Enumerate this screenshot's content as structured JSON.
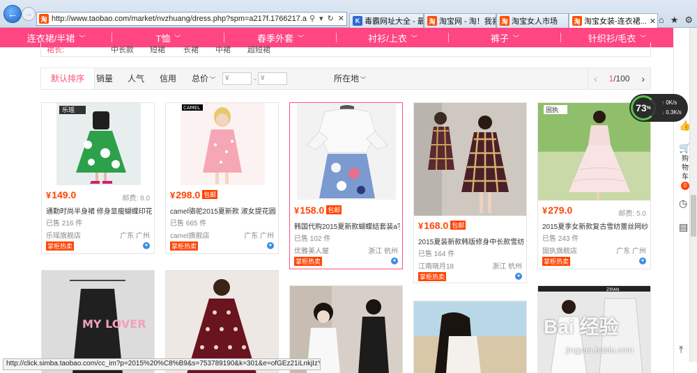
{
  "browser": {
    "url": "http://www.taobao.com/market/nvzhuang/dress.php?spm=a217f.1766217.a214d5w-",
    "tabs": [
      {
        "label": "毒霸网址大全 - 最...",
        "icon": "k",
        "active": false
      },
      {
        "label": "淘宝网 - 淘！我喜欢",
        "icon": "淘",
        "active": false
      },
      {
        "label": "淘宝女人市场",
        "icon": "淘",
        "active": false
      },
      {
        "label": "淘宝女装-连衣裙...",
        "icon": "淘",
        "active": true
      }
    ],
    "status_url": "http://click.simba.taobao.com/cc_im?p=2015%20%C8%B9&s=753789190&k=301&e=ofGEz21iLnkjIzY4..."
  },
  "categories": [
    "连衣裙/半裙",
    "T恤",
    "春季外套",
    "衬衫/上衣",
    "裤子",
    "针织衫/毛衣"
  ],
  "filter_row": {
    "label": "裙长:",
    "options": [
      "中长款",
      "短裙",
      "长裙",
      "中裙",
      "超短裙"
    ]
  },
  "sortbar": {
    "default": "默认排序",
    "sales": "销量",
    "popularity": "人气",
    "credit": "信用",
    "price": "总价",
    "price_min": "¥",
    "price_max": "¥",
    "location": "所在地",
    "page_current": "1",
    "page_total": "/100",
    "prev": "‹",
    "next": "›"
  },
  "products": [
    {
      "price": "149.0",
      "free": "",
      "mail": "邮费: 8.0",
      "title": "通勤时尚半身裙 修身显瘦蝴蝶印花...",
      "sold": "已售 216 件",
      "shop": "乐瑶旗舰店",
      "loc": "广东 广州",
      "badge": "掌柜热卖",
      "brand": "乐瑶"
    },
    {
      "price": "298.0",
      "free": "包邮",
      "mail": "",
      "title": "camel骆驼2015夏新款 淑女提花圆...",
      "sold": "已售 665 件",
      "shop": "camel旗舰店",
      "loc": "广东 广州",
      "badge": "掌柜热卖",
      "brand": "CAMEL"
    },
    {
      "price": "158.0",
      "free": "包邮",
      "mail": "",
      "title": "韩国代购2015夏新款蝴蝶结套装a字...",
      "sold": "已售 102 件",
      "shop": "优雅美人屋",
      "loc": "浙江 杭州",
      "badge": "掌柜热卖",
      "brand": ""
    },
    {
      "price": "168.0",
      "free": "包邮",
      "mail": "",
      "title": "2015夏装新款韩版修身中长款雪纺...",
      "sold": "已售 164 件",
      "shop": "江南晓月18",
      "loc": "浙江 杭州",
      "badge": "掌柜热卖",
      "brand": ""
    },
    {
      "price": "279.0",
      "free": "",
      "mail": "邮费: 5.0",
      "title": "2015夏季女新款复古雪纺蕾丝网纱...",
      "sold": "已售 243 件",
      "shop": "固执旗舰店",
      "loc": "广东 广州",
      "badge": "掌柜热卖",
      "brand": "固执"
    }
  ],
  "second_row": [
    {
      "brand": "MY LOVER"
    },
    {
      "brand": ""
    },
    {
      "brand": ""
    },
    {
      "brand": ""
    },
    {
      "brand": "ZIRAN"
    }
  ],
  "sidebar": {
    "cart_label": "购物车",
    "cart_count": "0"
  },
  "speed": {
    "percent": "73",
    "unit": "%",
    "up": "0K/s",
    "down": "0.3K/s"
  },
  "watermark": {
    "brand": "Bai 经验",
    "url": "jingyan.baidu.com"
  }
}
